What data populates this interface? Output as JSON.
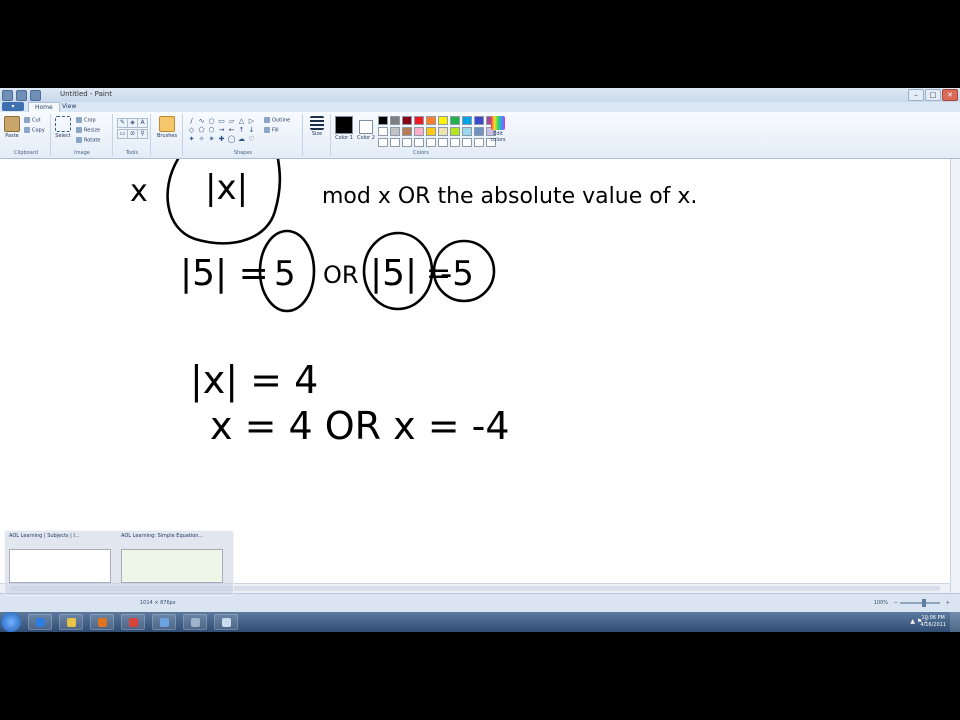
{
  "window": {
    "title": "Untitled - Paint",
    "controls": {
      "minimize": "–",
      "maximize": "□",
      "close": "✕"
    }
  },
  "tabs": [
    {
      "label": "Home",
      "active": true
    },
    {
      "label": "View",
      "active": false
    }
  ],
  "app_menu_icon": "paint-menu-icon",
  "ribbon": {
    "clipboard": {
      "label": "Clipboard",
      "paste": "Paste",
      "cut": "Cut",
      "copy": "Copy"
    },
    "image": {
      "label": "Image",
      "select": "Select",
      "crop": "Crop",
      "resize": "Resize",
      "rotate": "Rotate"
    },
    "tools": {
      "label": "Tools",
      "items": [
        "pencil-icon",
        "fill-icon",
        "text-icon",
        "eraser-icon",
        "color-picker-icon",
        "magnifier-icon"
      ],
      "glyphs": [
        "✎",
        "◈",
        "A",
        "▭",
        "⊘",
        "⚲"
      ]
    },
    "brushes": {
      "label": "Brushes"
    },
    "shapes": {
      "label": "Shapes",
      "glyphs": [
        "∕",
        "∿",
        "○",
        "▭",
        "▱",
        "△",
        "▷",
        "◇",
        "⬠",
        "⬡",
        "→",
        "←",
        "↑",
        "↓",
        "✦",
        "✧",
        "✶",
        "✚",
        "◯",
        "☁",
        "♡"
      ],
      "outline": "Outline",
      "fill": "Fill"
    },
    "size": {
      "label": "Size"
    },
    "colors": {
      "label": "Colors",
      "color1": "Color 1",
      "color2": "Color 2",
      "edit": "Edit colors",
      "color1_value": "#000000",
      "color2_value": "#ffffff",
      "swatches": [
        "#000000",
        "#7f7f7f",
        "#880015",
        "#ed1c24",
        "#ff7f27",
        "#fff200",
        "#22b14c",
        "#00a2e8",
        "#3f48cc",
        "#a349a4",
        "#ffffff",
        "#c3c3c3",
        "#b97a57",
        "#ffaec9",
        "#ffc90e",
        "#efe4b0",
        "#b5e61d",
        "#99d9ea",
        "#7092be",
        "#c8bfe7",
        "#ffffff",
        "#ffffff",
        "#ffffff",
        "#ffffff",
        "#ffffff",
        "#ffffff",
        "#ffffff",
        "#ffffff",
        "#ffffff",
        "#ffffff"
      ]
    }
  },
  "canvas": {
    "handwriting": {
      "line1_x": "x",
      "line1_absx": "|x|",
      "line1_text": "mod x  OR the absolute value of x.",
      "line2_a": "|5| =",
      "line2_b": "5",
      "line2_or": "OR",
      "line2_c": "|5|",
      "line2_eq": "=",
      "line2_d": "-5",
      "line3": "|x| = 4",
      "line4": "x = 4  OR  x = -4"
    }
  },
  "statusbar": {
    "dimensions": "1014 × 876px",
    "zoom": "100%",
    "zoom_minus": "−",
    "zoom_plus": "+"
  },
  "taskbar": {
    "clock_time": "10:06 PM",
    "clock_date": "4/16/2011",
    "tray": "▲ ⚑ ♪",
    "peek": [
      {
        "title": "AOL Learning | Subjects | I..."
      },
      {
        "title": "AOL Learning: Simple Equation..."
      }
    ],
    "apps": [
      {
        "name": "ie-icon",
        "color": "#2d7de0"
      },
      {
        "name": "folder-icon",
        "color": "#e8c34c"
      },
      {
        "name": "media-player-icon",
        "color": "#e0731f"
      },
      {
        "name": "chrome-icon",
        "color": "#d9443a"
      },
      {
        "name": "network-icon",
        "color": "#6aa4e0"
      },
      {
        "name": "camera-icon",
        "color": "#9fb3c9"
      },
      {
        "name": "paint-icon",
        "color": "#c9dced"
      }
    ]
  }
}
